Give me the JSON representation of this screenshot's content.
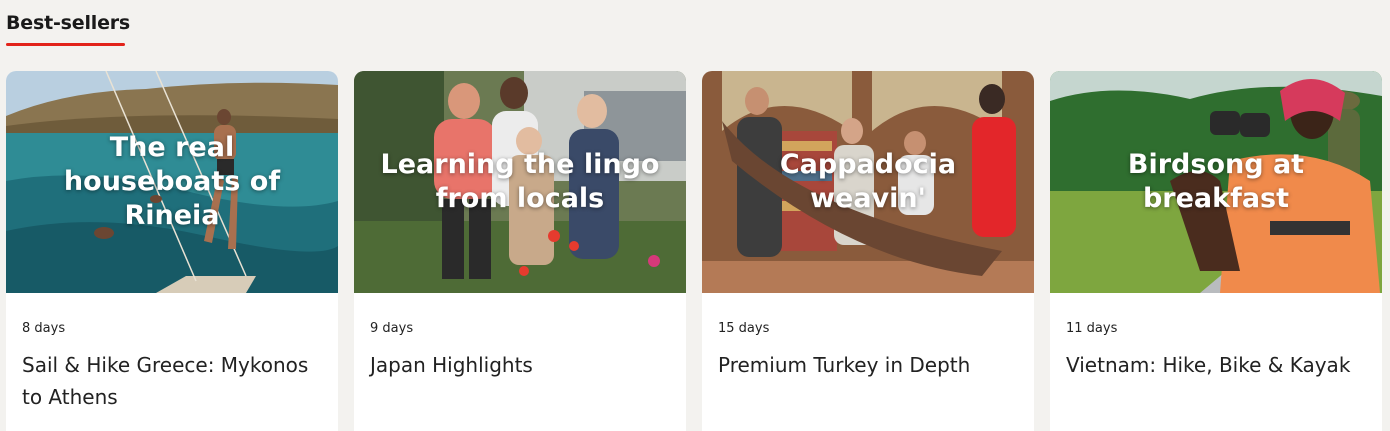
{
  "section": {
    "title": "Best-sellers"
  },
  "cards": [
    {
      "overlay": "The real houseboats of Rineia",
      "duration": "8 days",
      "name": "Sail & Hike Greece: Mykonos to Athens"
    },
    {
      "overlay": "Learning the lingo from locals",
      "duration": "9 days",
      "name": "Japan Highlights"
    },
    {
      "overlay": "Cappadocia weavin'",
      "duration": "15 days",
      "name": "Premium Turkey in Depth"
    },
    {
      "overlay": "Birdsong at breakfast",
      "duration": "11 days",
      "name": "Vietnam: Hike, Bike & Kayak"
    }
  ]
}
